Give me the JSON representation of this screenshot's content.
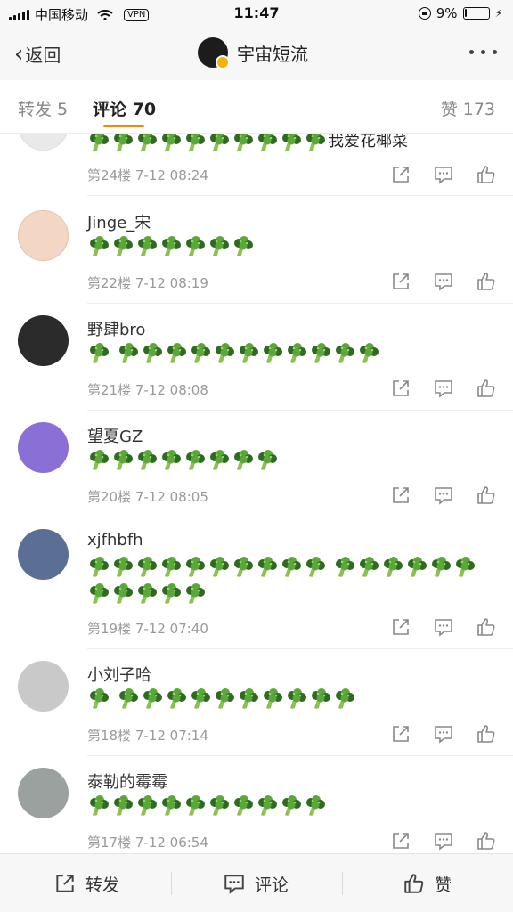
{
  "status_bar": {
    "carrier": "中国移动",
    "vpn": "VPN",
    "time": "11:47",
    "battery_percent": "9%",
    "battery_level": 0.09
  },
  "nav": {
    "back_label": "返回",
    "title": "宇宙短流"
  },
  "tabs": {
    "repost": "转发 5",
    "comment": "评论 70",
    "like": "赞 173"
  },
  "comments": [
    {
      "name": "",
      "text": "我爱花椰菜",
      "text_prefix_brocs": 10,
      "meta": "第24楼 7-12 08:24",
      "avatar_color": "#e9e9e9"
    },
    {
      "name": "Jinge_宋",
      "brocs": [
        7
      ],
      "meta": "第22楼 7-12 08:19",
      "avatar_color": "#f3d6c4"
    },
    {
      "name": "野肆bro",
      "brocs": [
        1,
        11
      ],
      "meta": "第21楼 7-12 08:08",
      "avatar_color": "#2b2b2b"
    },
    {
      "name": "望夏GZ",
      "brocs": [
        8
      ],
      "meta": "第20楼 7-12 08:05",
      "avatar_color": "#8a6fd6"
    },
    {
      "name": "xjfhbfh",
      "brocs": [
        10,
        6,
        5
      ],
      "meta": "第19楼 7-12 07:40",
      "avatar_color": "#5a6f93"
    },
    {
      "name": "小刘子哈",
      "brocs": [
        1,
        10
      ],
      "meta": "第18楼 7-12 07:14",
      "avatar_color": "#c9c9c9"
    },
    {
      "name": "泰勒的霉霉",
      "brocs": [
        10
      ],
      "meta": "第17楼 7-12 06:54",
      "avatar_color": "#9aa19f"
    }
  ],
  "bottom_bar": {
    "repost": "转发",
    "comment": "评论",
    "like": "赞"
  },
  "colors": {
    "accent": "#ff8200",
    "broccoli_dark": "#2f6b1f",
    "broccoli_light": "#5aa83a",
    "meta_gray": "#999999"
  }
}
